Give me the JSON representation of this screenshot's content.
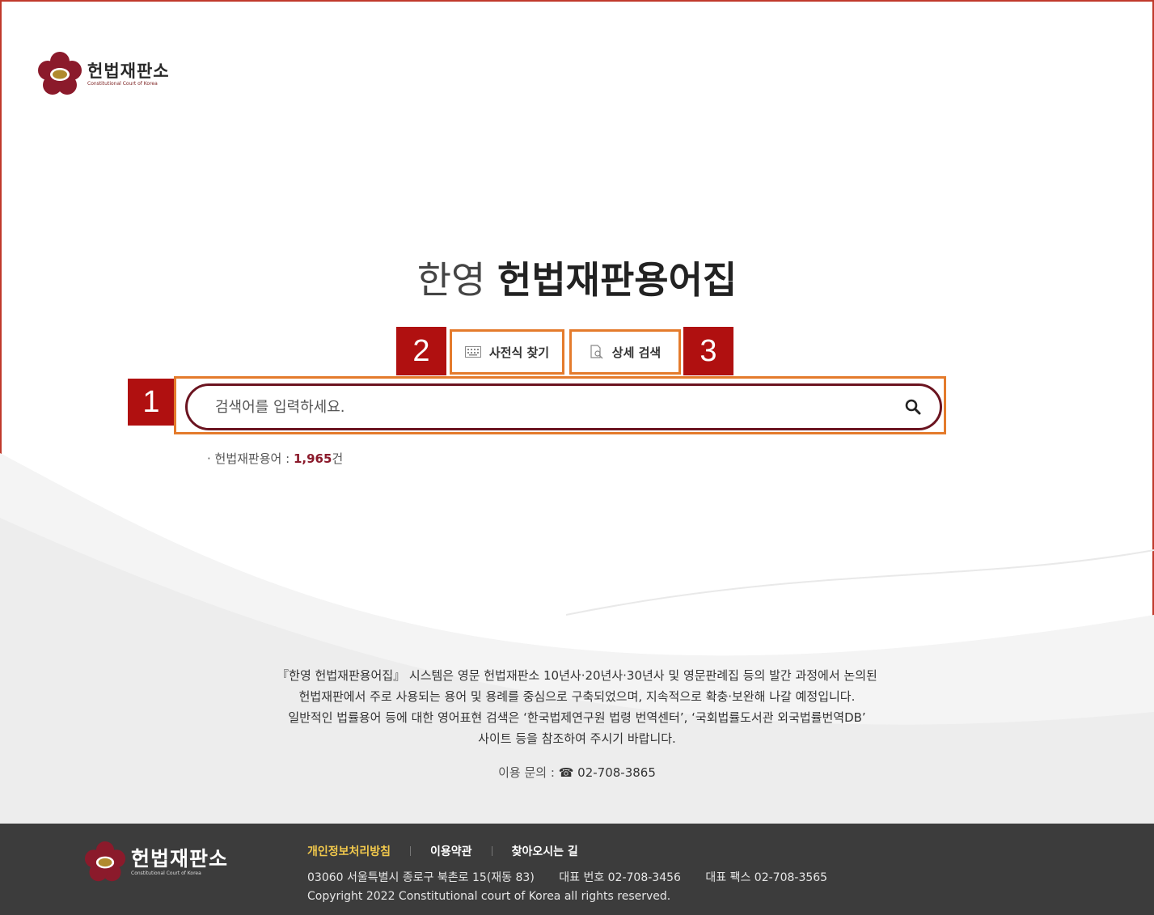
{
  "header": {
    "logo_ko": "헌법재판소",
    "logo_en": "Constitutional Court of Korea"
  },
  "title": {
    "light": "한영",
    "bold": "헌법재판용어집"
  },
  "annotations": [
    "1",
    "2",
    "3"
  ],
  "options": {
    "dictionary_label": "사전식 찾기",
    "advanced_label": "상세 검색"
  },
  "search": {
    "placeholder": "검색어를 입력하세요."
  },
  "count": {
    "label": "· 헌법재판용어 : ",
    "value": "1,965",
    "unit": "건"
  },
  "description": [
    "『한영 헌법재판용어집』 시스템은 영문 헌법재판소 10년사·20년사·30년사 및 영문판례집 등의 발간 과정에서 논의된",
    "헌법재판에서 주로 사용되는 용어 및 용례를 중심으로 구축되었으며, 지속적으로 확충·보완해 나갈 예정입니다.",
    "일반적인 법률용어 등에 대한 영어표현 검색은 ‘한국법제연구원 법령 번역센터’, ‘국회법률도서관 외국법률번역DB’",
    "사이트 등을 참조하여 주시기 바랍니다."
  ],
  "contact": {
    "label": "이용 문의 : ",
    "icon": "☎",
    "tel": "02-708-3865"
  },
  "footer": {
    "logo_ko": "헌법재판소",
    "logo_en": "Constitutional Court of Korea",
    "links": [
      "개인정보처리방침",
      "이용약관",
      "찾아오시는 길"
    ],
    "address": "03060 서울특별시 종로구 북촌로 15(재동 83)",
    "phone": "대표 번호 02-708-3456",
    "fax": "대표 팩스 02-708-3565",
    "copyright": "Copyright 2022 Constitutional court of Korea all rights reserved."
  },
  "colors": {
    "brand": "#8b1a2b",
    "annotation": "#b01010",
    "highlight": "#e47b2c",
    "footer_bg": "#3c3c3c"
  }
}
